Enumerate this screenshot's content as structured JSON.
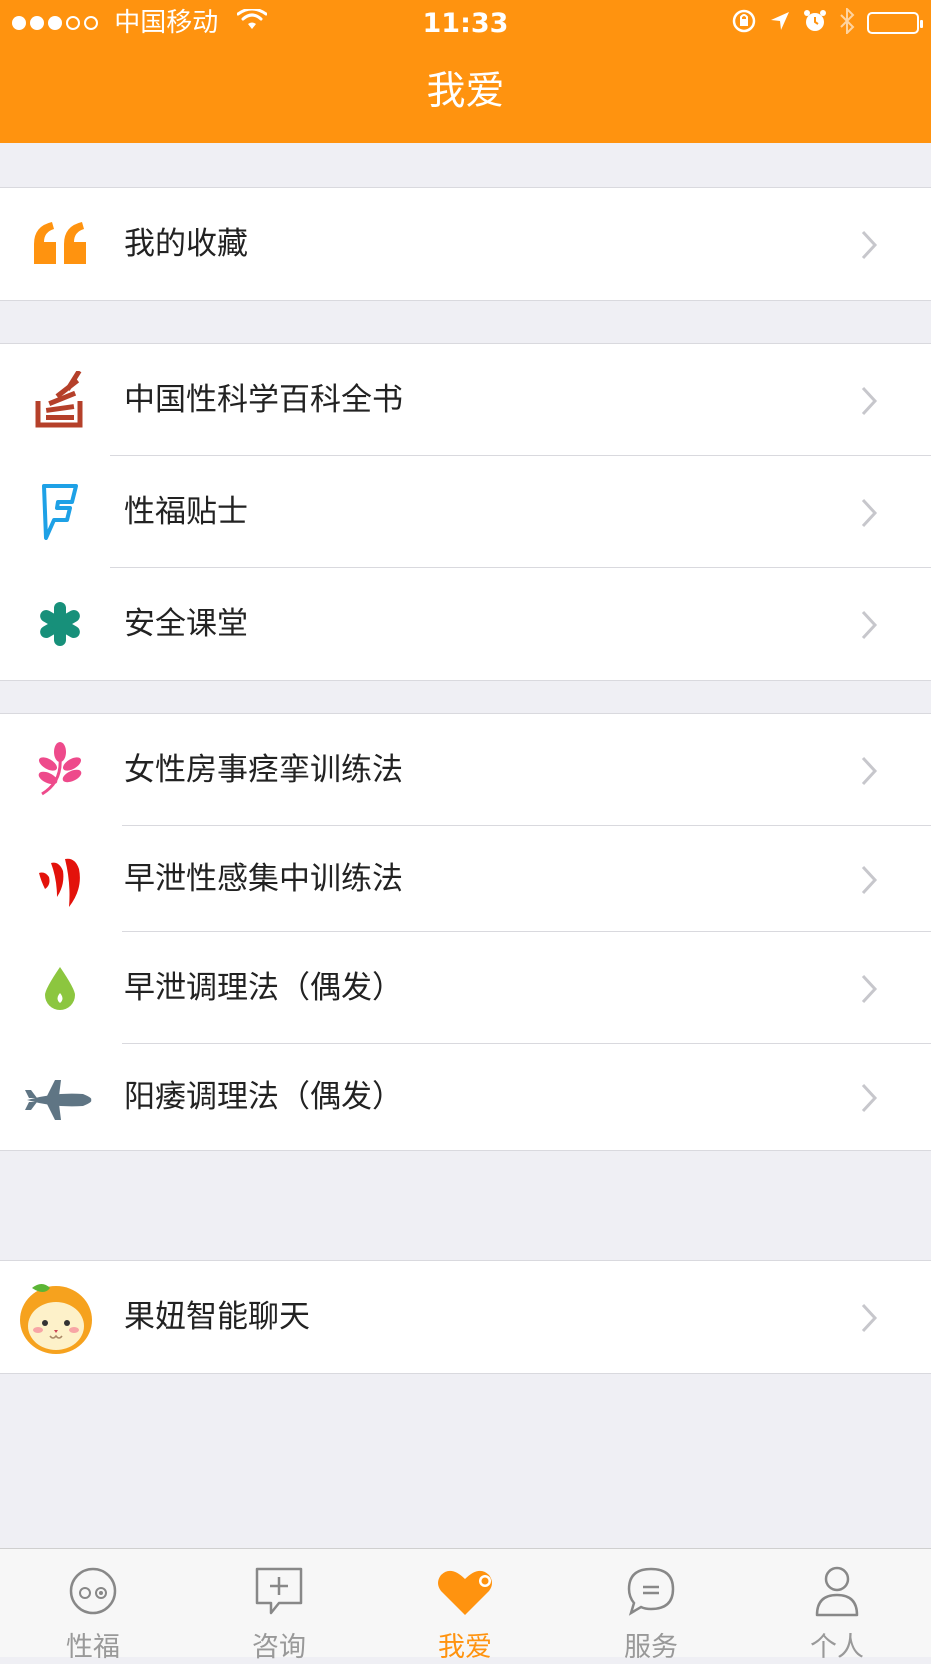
{
  "status_bar": {
    "carrier": "中国移动",
    "time": "11:33"
  },
  "nav": {
    "title": "我爱"
  },
  "colors": {
    "accent": "#ff930f",
    "separator": "#d9d9de",
    "background": "#efeff4"
  },
  "groups": [
    {
      "items": [
        {
          "label": "我的收藏",
          "icon": "quote-icon"
        }
      ]
    },
    {
      "items": [
        {
          "label": "中国性科学百科全书",
          "icon": "stack-books-icon"
        },
        {
          "label": "性福贴士",
          "icon": "foursquare-f-icon"
        },
        {
          "label": "安全课堂",
          "icon": "asterisk-icon"
        }
      ]
    },
    {
      "items": [
        {
          "label": "女性房事痉挛训练法",
          "icon": "leaf-branch-icon"
        },
        {
          "label": "早泄性感集中训练法",
          "icon": "red-waves-icon"
        },
        {
          "label": "早泄调理法（偶发）",
          "icon": "droplet-icon"
        },
        {
          "label": "阳痿调理法（偶发）",
          "icon": "jet-plane-icon"
        }
      ]
    },
    {
      "items": [
        {
          "label": "果妞智能聊天",
          "icon": "orange-mascot-icon"
        }
      ]
    }
  ],
  "tabbar": [
    {
      "label": "性福",
      "icon": "face-circle-icon",
      "active": false
    },
    {
      "label": "咨询",
      "icon": "plus-chat-icon",
      "active": false
    },
    {
      "label": "我爱",
      "icon": "heart-icon",
      "active": true
    },
    {
      "label": "服务",
      "icon": "speech-bubble-icon",
      "active": false
    },
    {
      "label": "个人",
      "icon": "person-icon",
      "active": false
    }
  ]
}
